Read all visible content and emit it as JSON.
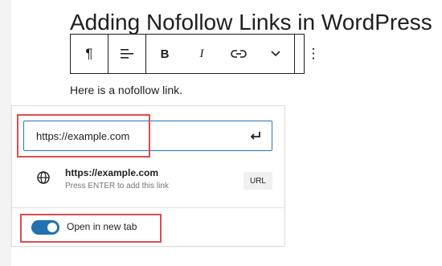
{
  "editor": {
    "title": "Adding Nofollow Links in WordPress",
    "paragraph": "Here is a nofollow link."
  },
  "toolbar": {
    "buttons": [
      {
        "name": "paragraph",
        "icon": "pilcrow-icon",
        "glyph": "¶"
      },
      {
        "name": "align",
        "icon": "align-left-icon",
        "glyph": ""
      },
      {
        "name": "bold",
        "icon": "bold-icon",
        "glyph": "B"
      },
      {
        "name": "italic",
        "icon": "italic-icon",
        "glyph": "I"
      },
      {
        "name": "link",
        "icon": "link-icon",
        "glyph": ""
      },
      {
        "name": "more",
        "icon": "chevron-down-icon",
        "glyph": ""
      },
      {
        "name": "options",
        "icon": "more-vertical-icon",
        "glyph": "⋮"
      }
    ]
  },
  "link_popover": {
    "url_value": "https://example.com",
    "suggestion": {
      "title": "https://example.com",
      "hint": "Press ENTER to add this link",
      "badge": "URL"
    },
    "toggle_label": "Open in new tab",
    "toggle_on": true
  },
  "colors": {
    "accent": "#2271b1",
    "highlight": "#e04b4b"
  }
}
